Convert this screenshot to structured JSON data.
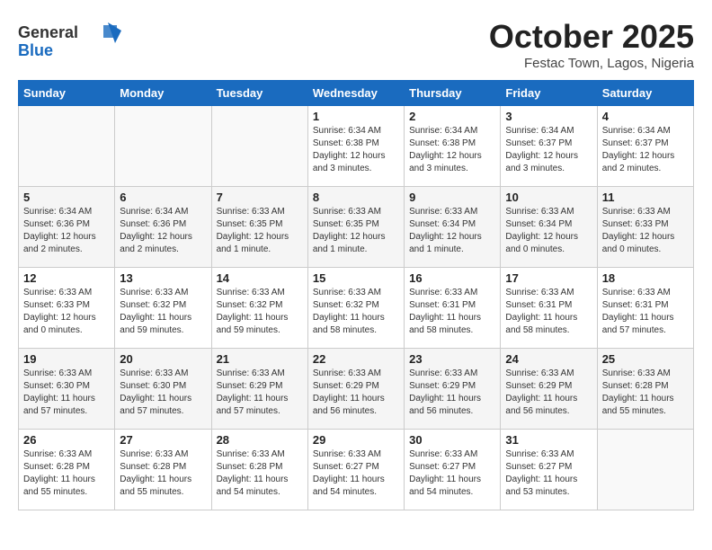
{
  "header": {
    "logo_line1": "General",
    "logo_line2": "Blue",
    "month_title": "October 2025",
    "subtitle": "Festac Town, Lagos, Nigeria"
  },
  "weekdays": [
    "Sunday",
    "Monday",
    "Tuesday",
    "Wednesday",
    "Thursday",
    "Friday",
    "Saturday"
  ],
  "weeks": [
    [
      {
        "day": "",
        "sunrise": "",
        "sunset": "",
        "daylight": "",
        "empty": true
      },
      {
        "day": "",
        "sunrise": "",
        "sunset": "",
        "daylight": "",
        "empty": true
      },
      {
        "day": "",
        "sunrise": "",
        "sunset": "",
        "daylight": "",
        "empty": true
      },
      {
        "day": "1",
        "sunrise": "Sunrise: 6:34 AM",
        "sunset": "Sunset: 6:38 PM",
        "daylight": "Daylight: 12 hours and 3 minutes.",
        "empty": false
      },
      {
        "day": "2",
        "sunrise": "Sunrise: 6:34 AM",
        "sunset": "Sunset: 6:38 PM",
        "daylight": "Daylight: 12 hours and 3 minutes.",
        "empty": false
      },
      {
        "day": "3",
        "sunrise": "Sunrise: 6:34 AM",
        "sunset": "Sunset: 6:37 PM",
        "daylight": "Daylight: 12 hours and 3 minutes.",
        "empty": false
      },
      {
        "day": "4",
        "sunrise": "Sunrise: 6:34 AM",
        "sunset": "Sunset: 6:37 PM",
        "daylight": "Daylight: 12 hours and 2 minutes.",
        "empty": false
      }
    ],
    [
      {
        "day": "5",
        "sunrise": "Sunrise: 6:34 AM",
        "sunset": "Sunset: 6:36 PM",
        "daylight": "Daylight: 12 hours and 2 minutes.",
        "empty": false
      },
      {
        "day": "6",
        "sunrise": "Sunrise: 6:34 AM",
        "sunset": "Sunset: 6:36 PM",
        "daylight": "Daylight: 12 hours and 2 minutes.",
        "empty": false
      },
      {
        "day": "7",
        "sunrise": "Sunrise: 6:33 AM",
        "sunset": "Sunset: 6:35 PM",
        "daylight": "Daylight: 12 hours and 1 minute.",
        "empty": false
      },
      {
        "day": "8",
        "sunrise": "Sunrise: 6:33 AM",
        "sunset": "Sunset: 6:35 PM",
        "daylight": "Daylight: 12 hours and 1 minute.",
        "empty": false
      },
      {
        "day": "9",
        "sunrise": "Sunrise: 6:33 AM",
        "sunset": "Sunset: 6:34 PM",
        "daylight": "Daylight: 12 hours and 1 minute.",
        "empty": false
      },
      {
        "day": "10",
        "sunrise": "Sunrise: 6:33 AM",
        "sunset": "Sunset: 6:34 PM",
        "daylight": "Daylight: 12 hours and 0 minutes.",
        "empty": false
      },
      {
        "day": "11",
        "sunrise": "Sunrise: 6:33 AM",
        "sunset": "Sunset: 6:33 PM",
        "daylight": "Daylight: 12 hours and 0 minutes.",
        "empty": false
      }
    ],
    [
      {
        "day": "12",
        "sunrise": "Sunrise: 6:33 AM",
        "sunset": "Sunset: 6:33 PM",
        "daylight": "Daylight: 12 hours and 0 minutes.",
        "empty": false
      },
      {
        "day": "13",
        "sunrise": "Sunrise: 6:33 AM",
        "sunset": "Sunset: 6:32 PM",
        "daylight": "Daylight: 11 hours and 59 minutes.",
        "empty": false
      },
      {
        "day": "14",
        "sunrise": "Sunrise: 6:33 AM",
        "sunset": "Sunset: 6:32 PM",
        "daylight": "Daylight: 11 hours and 59 minutes.",
        "empty": false
      },
      {
        "day": "15",
        "sunrise": "Sunrise: 6:33 AM",
        "sunset": "Sunset: 6:32 PM",
        "daylight": "Daylight: 11 hours and 58 minutes.",
        "empty": false
      },
      {
        "day": "16",
        "sunrise": "Sunrise: 6:33 AM",
        "sunset": "Sunset: 6:31 PM",
        "daylight": "Daylight: 11 hours and 58 minutes.",
        "empty": false
      },
      {
        "day": "17",
        "sunrise": "Sunrise: 6:33 AM",
        "sunset": "Sunset: 6:31 PM",
        "daylight": "Daylight: 11 hours and 58 minutes.",
        "empty": false
      },
      {
        "day": "18",
        "sunrise": "Sunrise: 6:33 AM",
        "sunset": "Sunset: 6:31 PM",
        "daylight": "Daylight: 11 hours and 57 minutes.",
        "empty": false
      }
    ],
    [
      {
        "day": "19",
        "sunrise": "Sunrise: 6:33 AM",
        "sunset": "Sunset: 6:30 PM",
        "daylight": "Daylight: 11 hours and 57 minutes.",
        "empty": false
      },
      {
        "day": "20",
        "sunrise": "Sunrise: 6:33 AM",
        "sunset": "Sunset: 6:30 PM",
        "daylight": "Daylight: 11 hours and 57 minutes.",
        "empty": false
      },
      {
        "day": "21",
        "sunrise": "Sunrise: 6:33 AM",
        "sunset": "Sunset: 6:29 PM",
        "daylight": "Daylight: 11 hours and 57 minutes.",
        "empty": false
      },
      {
        "day": "22",
        "sunrise": "Sunrise: 6:33 AM",
        "sunset": "Sunset: 6:29 PM",
        "daylight": "Daylight: 11 hours and 56 minutes.",
        "empty": false
      },
      {
        "day": "23",
        "sunrise": "Sunrise: 6:33 AM",
        "sunset": "Sunset: 6:29 PM",
        "daylight": "Daylight: 11 hours and 56 minutes.",
        "empty": false
      },
      {
        "day": "24",
        "sunrise": "Sunrise: 6:33 AM",
        "sunset": "Sunset: 6:29 PM",
        "daylight": "Daylight: 11 hours and 56 minutes.",
        "empty": false
      },
      {
        "day": "25",
        "sunrise": "Sunrise: 6:33 AM",
        "sunset": "Sunset: 6:28 PM",
        "daylight": "Daylight: 11 hours and 55 minutes.",
        "empty": false
      }
    ],
    [
      {
        "day": "26",
        "sunrise": "Sunrise: 6:33 AM",
        "sunset": "Sunset: 6:28 PM",
        "daylight": "Daylight: 11 hours and 55 minutes.",
        "empty": false
      },
      {
        "day": "27",
        "sunrise": "Sunrise: 6:33 AM",
        "sunset": "Sunset: 6:28 PM",
        "daylight": "Daylight: 11 hours and 55 minutes.",
        "empty": false
      },
      {
        "day": "28",
        "sunrise": "Sunrise: 6:33 AM",
        "sunset": "Sunset: 6:28 PM",
        "daylight": "Daylight: 11 hours and 54 minutes.",
        "empty": false
      },
      {
        "day": "29",
        "sunrise": "Sunrise: 6:33 AM",
        "sunset": "Sunset: 6:27 PM",
        "daylight": "Daylight: 11 hours and 54 minutes.",
        "empty": false
      },
      {
        "day": "30",
        "sunrise": "Sunrise: 6:33 AM",
        "sunset": "Sunset: 6:27 PM",
        "daylight": "Daylight: 11 hours and 54 minutes.",
        "empty": false
      },
      {
        "day": "31",
        "sunrise": "Sunrise: 6:33 AM",
        "sunset": "Sunset: 6:27 PM",
        "daylight": "Daylight: 11 hours and 53 minutes.",
        "empty": false
      },
      {
        "day": "",
        "sunrise": "",
        "sunset": "",
        "daylight": "",
        "empty": true
      }
    ]
  ]
}
